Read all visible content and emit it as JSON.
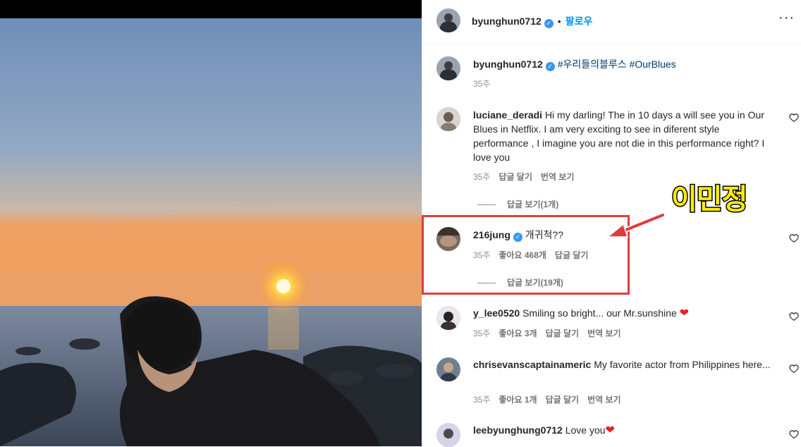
{
  "header": {
    "username": "byunghun0712",
    "dot": "•",
    "follow_label": "팔로우",
    "more_icon": "more-options-icon"
  },
  "caption": {
    "username": "byunghun0712",
    "hashtag1": "#우리들의블루스",
    "hashtag2": "#OurBlues",
    "time": "35주"
  },
  "comments": [
    {
      "username": "luciane_deradi",
      "text": "Hi my darling! The in 10 days a will see you in Our Blues in Netflix. I am very exciting to see in diferent style performance , I imagine you are not die in this performance right? I love you",
      "time": "35주",
      "reply": "답글 달기",
      "translate": "번역 보기",
      "view_replies": "답글 보기(1개)"
    },
    {
      "username": "216jung",
      "text": "개귀척??",
      "time": "35주",
      "likes": "좋아요 468개",
      "reply": "답글 달기",
      "view_replies": "답글 보기(19개)"
    },
    {
      "username": "y_lee0520",
      "text": "Smiling so bright... our Mr.sunshine",
      "time": "35주",
      "likes": "좋아요 3개",
      "reply": "답글 달기",
      "translate": "번역 보기"
    },
    {
      "username": "chrisevanscaptainameric",
      "text": "My favorite actor from Philippines here...",
      "time": "35주",
      "likes": "좋아요 1개",
      "reply": "답글 달기",
      "translate": "번역 보기"
    },
    {
      "username": "leebyunghung0712",
      "text": "Love you"
    }
  ],
  "annotation": {
    "label": "이민정",
    "box_color": "#e03c3c",
    "label_color": "#ffeb00"
  },
  "colors": {
    "link": "#0095f6",
    "hashtag": "#00376b",
    "verified": "#3897f0",
    "muted": "#8e8e8e"
  }
}
